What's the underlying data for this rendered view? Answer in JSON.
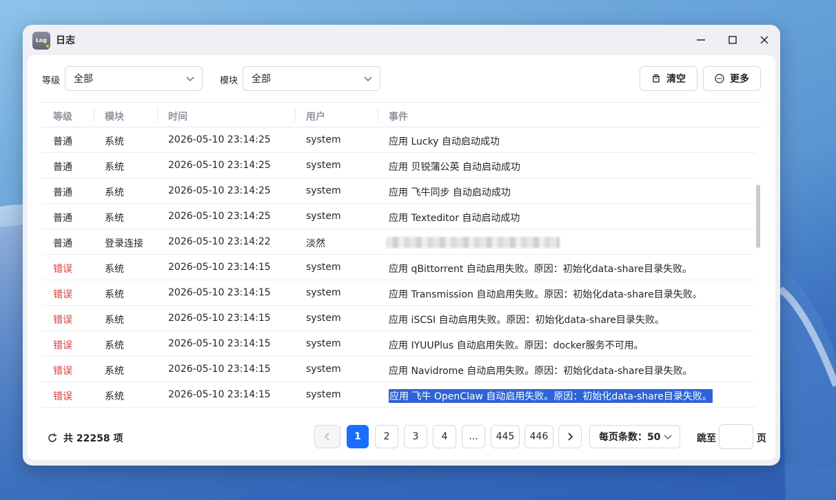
{
  "window": {
    "title": "日志",
    "app_icon_text": "Log"
  },
  "filters": {
    "level_label": "等级",
    "level_value": "全部",
    "module_label": "模块",
    "module_value": "全部"
  },
  "actions": {
    "clear_label": "清空",
    "more_label": "更多"
  },
  "table": {
    "headers": [
      "等级",
      "模块",
      "时间",
      "用户",
      "事件"
    ],
    "rows": [
      {
        "level": "普通",
        "module": "系统",
        "time": "2026-05-10 23:14:25",
        "user": "system",
        "event": "应用 Lucky 自动启动成功",
        "error": false
      },
      {
        "level": "普通",
        "module": "系统",
        "time": "2026-05-10 23:14:25",
        "user": "system",
        "event": "应用 贝锐蒲公英 自动启动成功",
        "error": false
      },
      {
        "level": "普通",
        "module": "系统",
        "time": "2026-05-10 23:14:25",
        "user": "system",
        "event": "应用 飞牛同步 自动启动成功",
        "error": false
      },
      {
        "level": "普通",
        "module": "系统",
        "time": "2026-05-10 23:14:25",
        "user": "system",
        "event": "应用 Texteditor 自动启动成功",
        "error": false
      },
      {
        "level": "普通",
        "module": "登录连接",
        "time": "2026-05-10 23:14:22",
        "user": "淡然",
        "event": "",
        "error": false,
        "blurred": true
      },
      {
        "level": "错误",
        "module": "系统",
        "time": "2026-05-10 23:14:15",
        "user": "system",
        "event": "应用 qBittorrent 自动启用失败。原因：初始化data-share目录失败。",
        "error": true
      },
      {
        "level": "错误",
        "module": "系统",
        "time": "2026-05-10 23:14:15",
        "user": "system",
        "event": "应用 Transmission 自动启用失败。原因：初始化data-share目录失败。",
        "error": true
      },
      {
        "level": "错误",
        "module": "系统",
        "time": "2026-05-10 23:14:15",
        "user": "system",
        "event": "应用 iSCSI 自动启用失败。原因：初始化data-share目录失败。",
        "error": true
      },
      {
        "level": "错误",
        "module": "系统",
        "time": "2026-05-10 23:14:15",
        "user": "system",
        "event": "应用 IYUUPlus 自动启用失败。原因：docker服务不可用。",
        "error": true
      },
      {
        "level": "错误",
        "module": "系统",
        "time": "2026-05-10 23:14:15",
        "user": "system",
        "event": "应用 Navidrome 自动启用失败。原因：初始化data-share目录失败。",
        "error": true
      },
      {
        "level": "错误",
        "module": "系统",
        "time": "2026-05-10 23:14:15",
        "user": "system",
        "event": "应用 飞牛 OpenClaw 自动启用失败。原因：初始化data-share目录失败。",
        "error": true,
        "selected": true
      }
    ]
  },
  "footer": {
    "total_text": "共 22258 项",
    "pages": [
      "1",
      "2",
      "3",
      "4",
      "...",
      "445",
      "446"
    ],
    "active_page": "1",
    "page_size_text": "每页条数：50",
    "jump_label": "跳至",
    "jump_value": "",
    "page_unit": "页"
  },
  "colors": {
    "accent": "#1a6dff",
    "error": "#d63b3b",
    "selection": "#2d63d8"
  }
}
